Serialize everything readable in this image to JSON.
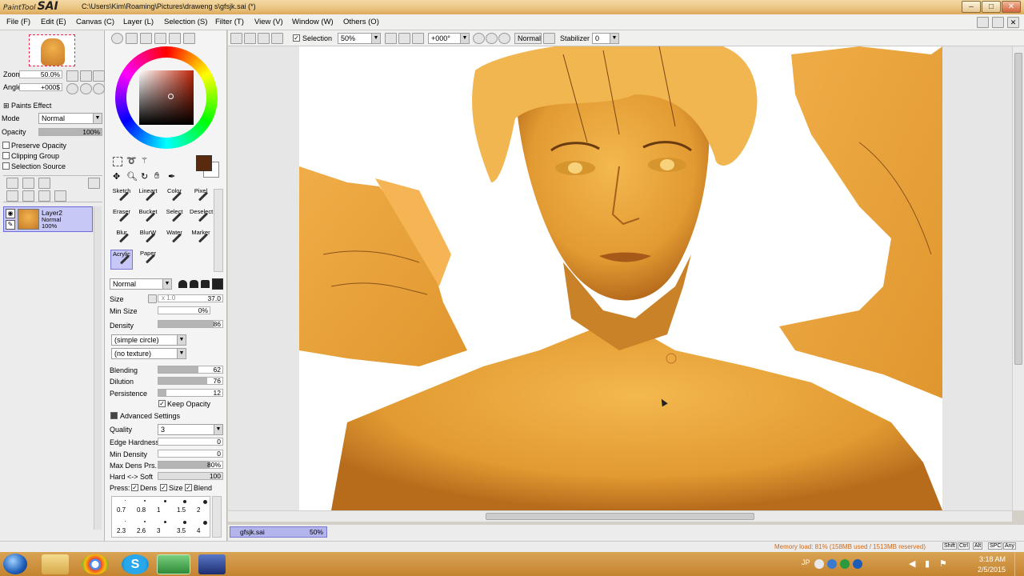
{
  "app": {
    "logo": "SAI",
    "logo_prefix": "PaintTool",
    "title_path": "C:\\Users\\Kim\\Roaming\\Pictures\\draweng s\\gfsjk.sai (*)"
  },
  "menu": [
    "File (F)",
    "Edit (E)",
    "Canvas (C)",
    "Layer (L)",
    "Selection (S)",
    "Filter (T)",
    "View (V)",
    "Window (W)",
    "Others (O)"
  ],
  "navigator": {
    "zoom_label": "Zoom",
    "zoom_value": "50.0%",
    "angle_label": "Angle",
    "angle_value": "+000$"
  },
  "layer_panel": {
    "paints_effect": "Paints Effect",
    "mode_label": "Mode",
    "mode_value": "Normal",
    "opacity_label": "Opacity",
    "opacity_value": "100%",
    "opacity_fill": 1.0,
    "preserve_opacity": "Preserve Opacity",
    "clipping_group": "Clipping Group",
    "selection_source": "Selection Source",
    "layer_name": "Layer2",
    "layer_mode": "Normal",
    "layer_opacity": "100%"
  },
  "tools": {
    "brushes": [
      {
        "label": "Sketch"
      },
      {
        "label": "Lineart"
      },
      {
        "label": "Color"
      },
      {
        "label": "Pixel"
      },
      {
        "label": "Eraser"
      },
      {
        "label": "Bucket"
      },
      {
        "label": "Select"
      },
      {
        "label": "Deselect"
      },
      {
        "label": "Blur"
      },
      {
        "label": "BlurW"
      },
      {
        "label": "Water"
      },
      {
        "label": "Marker"
      },
      {
        "label": "Acrylic"
      },
      {
        "label": "Paper"
      }
    ],
    "blend_mode": "Normal",
    "size_label": "Size",
    "size_mult": "x 1.0",
    "size_value": "37.0",
    "min_size_label": "Min Size",
    "min_size_value": "0%",
    "density_label": "Density",
    "density_value": "86",
    "density_fill": 0.86,
    "shape": "(simple circle)",
    "texture": "(no texture)",
    "blending_label": "Blending",
    "blending_value": "62",
    "blending_fill": 0.62,
    "dilution_label": "Dilution",
    "dilution_value": "76",
    "dilution_fill": 0.76,
    "persistence_label": "Persistence",
    "persistence_value": "12",
    "persistence_fill": 0.12,
    "keep_opacity": "Keep Opacity",
    "advanced": "Advanced Settings",
    "quality_label": "Quality",
    "quality_value": "3",
    "edge_label": "Edge Hardness",
    "edge_value": "0",
    "min_density_label": "Min Density",
    "min_density_value": "0",
    "max_dens_label": "Max Dens Prs.",
    "max_dens_value": "80%",
    "max_dens_fill": 0.8,
    "hard_soft_label": "Hard <-> Soft",
    "hard_soft_value": "100",
    "hard_soft_fill": 1.0,
    "press_label": "Press:",
    "press_dens": "Dens",
    "press_size": "Size",
    "press_blend": "Blend",
    "presets_row1": [
      "0.7",
      "0.8",
      "1",
      "1.5",
      "2"
    ],
    "presets_row2": [
      "2.3",
      "2.6",
      "3",
      "3.5",
      "4"
    ]
  },
  "canvas_toolbar": {
    "selection": "Selection",
    "zoom": "50%",
    "angle": "+000°",
    "mode": "Normal",
    "stabilizer_label": "Stabilizer",
    "stabilizer_value": "0"
  },
  "status": {
    "doc_tab": "gfsjk.sai",
    "doc_zoom": "50%",
    "memory": "Memory load: 81% (158MB used / 1513MB reserved)",
    "keys": [
      "Shift",
      "Ctrl",
      "Alt",
      "SPC",
      "Any"
    ]
  },
  "taskbar": {
    "lang": "JP",
    "time": "3:18 AM",
    "date": "2/5/2015"
  },
  "colors": {
    "current_color": "#5a2a0e",
    "skin": "#e8a33b",
    "accent_titlebar": "#e9c47f"
  }
}
